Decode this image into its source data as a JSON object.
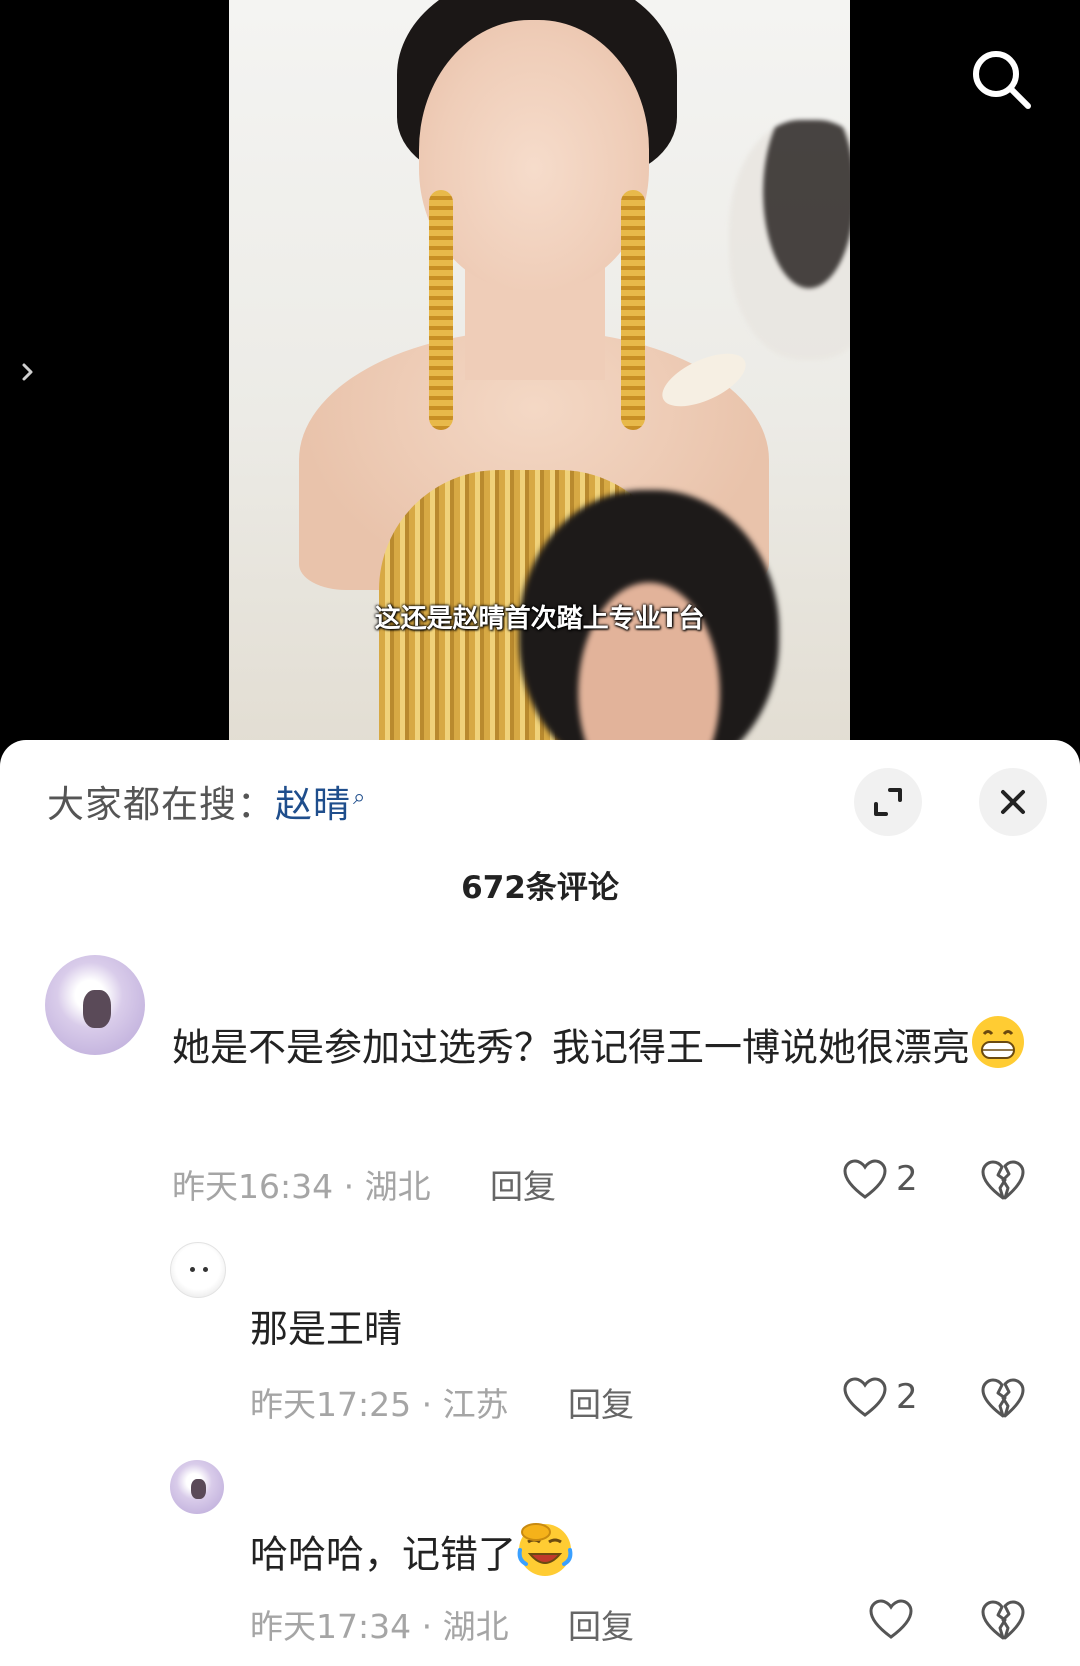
{
  "video": {
    "subtitle": "这还是赵晴首次踏上专业T台"
  },
  "header": {
    "hot_search_label": "大家都在搜：",
    "hot_search_keyword": "赵晴",
    "comment_count": "672条评论"
  },
  "comments": [
    {
      "text": "她是不是参加过选秀？我记得王一博说她很漂亮",
      "emoji": "grinning-face",
      "time": "昨天16:34",
      "location": "湖北",
      "reply_label": "回复",
      "likes": "2"
    },
    {
      "text": "那是王晴",
      "time": "昨天17:25",
      "location": "江苏",
      "reply_label": "回复",
      "likes": "2"
    },
    {
      "text": "哈哈哈，记错了",
      "emoji": "face-palm-laughing",
      "time": "昨天17:34",
      "location": "湖北",
      "reply_label": "回复",
      "likes": ""
    }
  ],
  "meta_separator": " · ",
  "colors": {
    "keyword": "#1f4e8c",
    "meta": "#a5a5a5",
    "sheet_bg": "#ffffff"
  },
  "icons": [
    "search-icon",
    "chevron-right-icon",
    "expand-icon",
    "close-icon",
    "heart-icon",
    "broken-heart-icon"
  ]
}
